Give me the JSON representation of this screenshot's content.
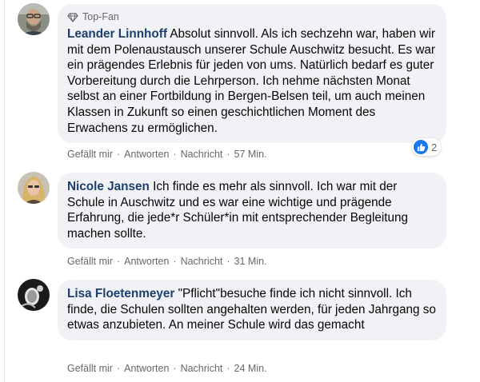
{
  "comments": [
    {
      "badge": "Top-Fan",
      "author": "Leander Linnhoff",
      "text": "Absolut sinnvoll. Als ich sechzehn war, haben wir mit dem Polenaustausch unserer Schule Auschwitz besucht. Es war ein prägendes Erlebnis für jeden von ums. Natürlich bedarf es guter Vorbereitung durch die Lehrperson. Ich nehme nächsten Monat selbst an einer Fortbildung in Bergen-Belsen teil, um auch meinen Klassen in Zukunft so einen geschichtlichen Moment des Erwachens zu ermöglichen.",
      "like_label": "Gefällt mir",
      "reply_label": "Antworten",
      "message_label": "Nachricht",
      "time": "57 Min.",
      "reaction_count": "2"
    },
    {
      "author": "Nicole Jansen",
      "text": "Ich finde es mehr als sinnvoll. Ich war mit der Schule in Auschwitz und es war eine wichtige und prägende Erfahrung, die jede*r Schüler*in mit entsprechender Begleitung machen sollte.",
      "like_label": "Gefällt mir",
      "reply_label": "Antworten",
      "message_label": "Nachricht",
      "time": "31 Min."
    },
    {
      "author": "Lisa Floetenmeyer",
      "text": "\"Pflicht\"besuche finde ich nicht sinnvoll. Ich finde, die Schulen sollten angehalten werden, für jeden Jahrgang so etwas anzubieten. An meiner Schule wird das gemacht",
      "like_label": "Gefällt mir",
      "reply_label": "Antworten",
      "message_label": "Nachricht",
      "time": "24 Min."
    }
  ],
  "separator": "·",
  "colors": {
    "bubble": "#f0f2f5",
    "author": "#1c3f6e",
    "meta": "#65676b",
    "like_blue": "#1877f2"
  }
}
